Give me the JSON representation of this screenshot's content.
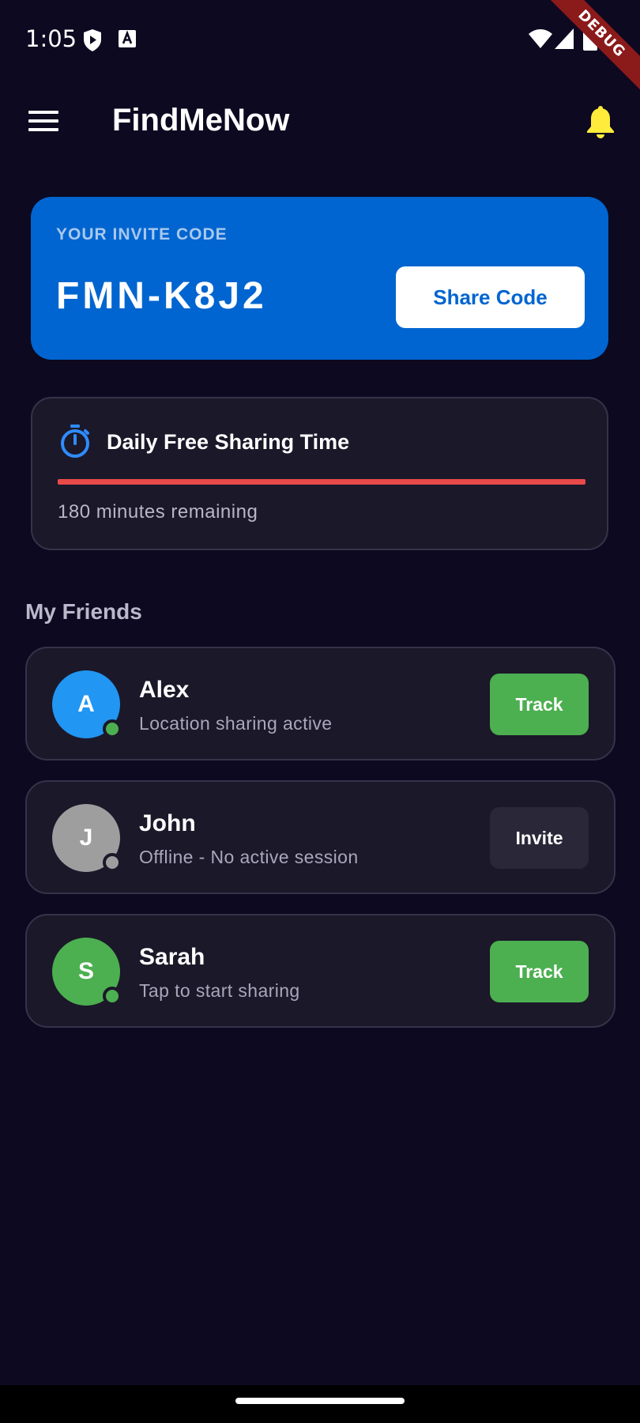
{
  "status_bar": {
    "time": "1:05",
    "icons": [
      "shield-icon",
      "font-download-icon",
      "wifi-icon",
      "signal-icon",
      "battery-icon"
    ]
  },
  "debug_banner": "DEBUG",
  "app_bar": {
    "title": "FindMeNow",
    "menu_icon": "menu-icon",
    "notification_icon": "bell-icon",
    "bell_color": "#ffeb3b"
  },
  "invite": {
    "label": "YOUR INVITE CODE",
    "code": "FMN-K8J2",
    "share_label": "Share Code",
    "card_color": "#0065d0"
  },
  "sharing_time": {
    "title": "Daily Free Sharing Time",
    "icon": "timer-icon",
    "remaining_text": "180 minutes remaining",
    "progress_fraction": 1.0,
    "progress_color": "#e84a4a"
  },
  "friends_section": {
    "title": "My Friends",
    "friends": [
      {
        "initial": "A",
        "name": "Alex",
        "status": "Location sharing active",
        "avatar_color": "#2196f3",
        "online_color": "#4caf50",
        "action": "Track",
        "action_color": "#4caf50"
      },
      {
        "initial": "J",
        "name": "John",
        "status": "Offline - No active session",
        "avatar_color": "#9e9e9e",
        "online_color": "#9e9e9e",
        "action": "Invite",
        "action_color": "#2a2738"
      },
      {
        "initial": "S",
        "name": "Sarah",
        "status": "Tap to start sharing",
        "avatar_color": "#4caf50",
        "online_color": "#4caf50",
        "action": "Track",
        "action_color": "#4caf50"
      }
    ]
  }
}
